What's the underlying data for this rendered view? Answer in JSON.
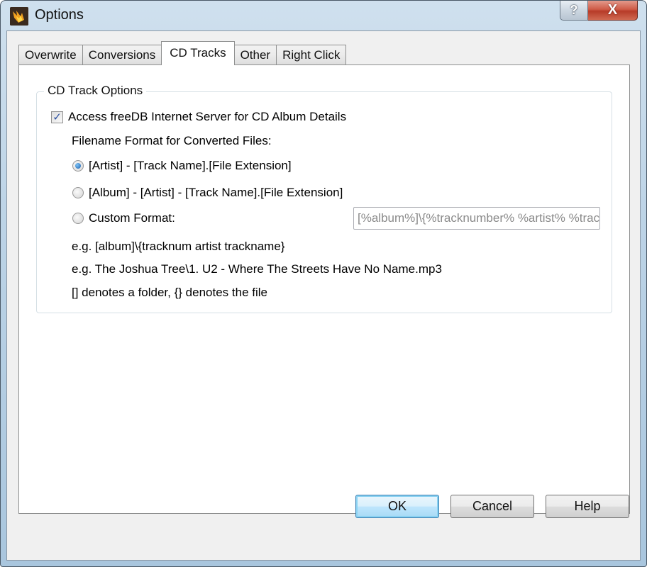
{
  "window": {
    "title": "Options",
    "icon": "app-flame-icon",
    "caption_buttons": {
      "help": "?",
      "close": "X"
    }
  },
  "tabs": [
    {
      "label": "Overwrite",
      "active": false
    },
    {
      "label": "Conversions",
      "active": false
    },
    {
      "label": "CD Tracks",
      "active": true
    },
    {
      "label": "Other",
      "active": false
    },
    {
      "label": "Right Click",
      "active": false
    }
  ],
  "cd_tracks": {
    "group_title": "CD Track Options",
    "freedb_checkbox": {
      "label": "Access freeDB Internet Server for CD Album Details",
      "checked": true
    },
    "filename_format_label": "Filename Format for Converted Files:",
    "format_options": [
      {
        "label": "[Artist] - [Track Name].[File Extension]",
        "selected": true
      },
      {
        "label": "[Album] - [Artist] - [Track Name].[File Extension]",
        "selected": false
      },
      {
        "label": "Custom Format:",
        "selected": false
      }
    ],
    "custom_format_value": "[%album%]\\{%tracknumber% %artist% %trac",
    "examples": [
      "e.g. [album]\\{tracknum artist trackname}",
      "e.g. The Joshua Tree\\1. U2 - Where The Streets Have No Name.mp3",
      "[] denotes a folder, {} denotes the file"
    ]
  },
  "buttons": {
    "ok": "OK",
    "cancel": "Cancel",
    "help": "Help"
  }
}
